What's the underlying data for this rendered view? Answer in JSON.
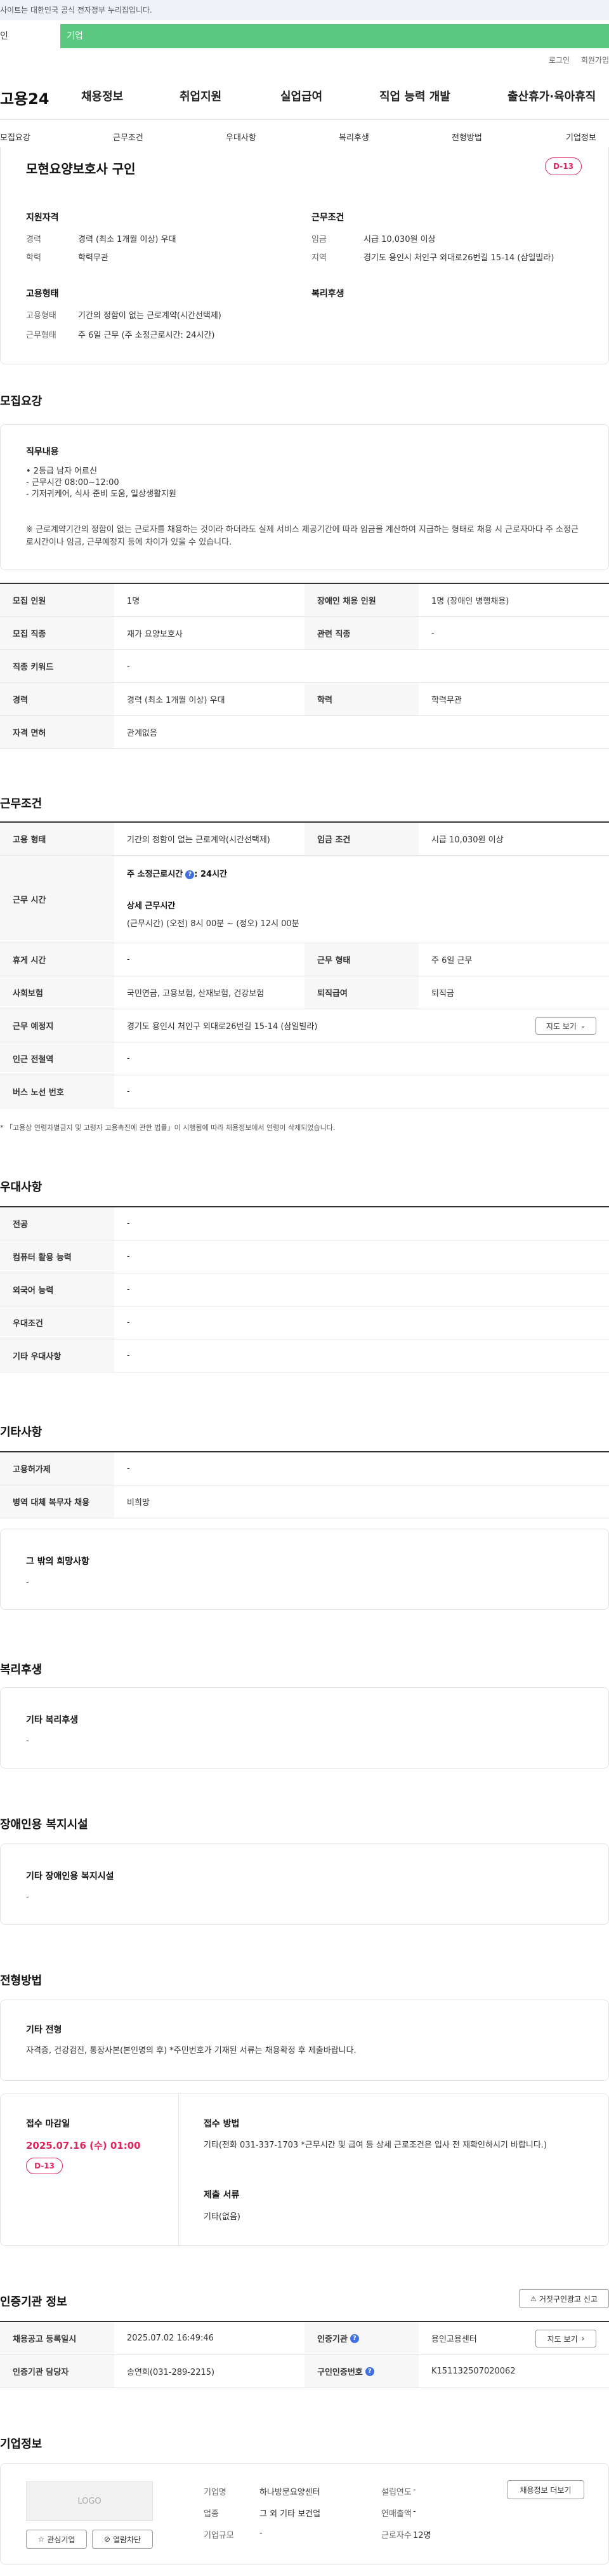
{
  "topbar": {
    "notice": "사이트는 대한민국 공식 전자정부 누리집입니다."
  },
  "tabs": {
    "individual": "인",
    "business": "기업"
  },
  "util": {
    "login": "로그인",
    "join": "회원가입"
  },
  "header": {
    "logo": "고용24",
    "nav": [
      "채용정보",
      "취업지원",
      "실업급여",
      "직업 능력 개발",
      "출산휴가·육아휴직"
    ]
  },
  "subnav": [
    "모집요강",
    "근무조건",
    "우대사항",
    "복리후생",
    "전형방법",
    "기업정보"
  ],
  "summary": {
    "title": "모현요양보호사 구인",
    "dday": "D-13",
    "qual_title": "지원자격",
    "career_label": "경력",
    "career": "경력 (최소 1개월 이상) 우대",
    "edu_label": "학력",
    "edu": "학력무관",
    "emp_title": "고용형태",
    "emptype_label": "고용형태",
    "emptype": "기간의 정함이 없는 근로계약(시간선택제)",
    "work_label": "근무형태",
    "work": "주 6일 근무 (주 소정근로시간: 24시간)",
    "cond_title": "근무조건",
    "wage_label": "임금",
    "wage": "시급 10,030원 이상",
    "area_label": "지역",
    "area": "경기도 용인시 처인구 외대로26번길 15-14 (삼일빌라)",
    "welfare_title": "복리후생"
  },
  "recruit": {
    "heading": "모집요강",
    "job_title": "직무내용",
    "job_lines": [
      "• 2등급 남자 어르신",
      "- 근무시간 08:00~12:00",
      "- 기저귀케어, 식사 준비 도움, 일상생활지원"
    ],
    "notice": "※ 근로계약기간의 정함이 없는 근로자를 채용하는 것이라 하더라도 실제 서비스 제공기간에 따라 임금을 계산하여 지급하는 형태로 채용 시 근로자마다 주 소정근로시간이나 임금, 근무예정지 등에 차이가 있을 수 있습니다.",
    "rows": [
      {
        "l1": "모집 인원",
        "v1": "1명",
        "l2": "장애인 채용 인원",
        "v2": "1명 (장애인 병행채용)"
      },
      {
        "l1": "모집 직종",
        "v1": "재가 요양보호사",
        "l2": "관련 직종",
        "v2": "-"
      },
      {
        "l1": "직종 키워드",
        "v1": "-"
      },
      {
        "l1": "경력",
        "v1": "경력 (최소 1개월 이상) 우대",
        "l2": "학력",
        "v2": "학력무관"
      },
      {
        "l1": "자격 면허",
        "v1": "관계없음"
      }
    ]
  },
  "conditions": {
    "heading": "근무조건",
    "type_label": "고용 형태",
    "type": "기간의 정함이 없는 근로계약(시간선택제)",
    "wage_label": "임금 조건",
    "wage": "시급 10,030원 이상",
    "hours_label": "근무 시간",
    "weekly_label": "주 소정근로시간",
    "weekly": ": 24시간",
    "detail_label": "상세 근무시간",
    "detail": "(근무시간) (오전) 8시 00분 ~ (정오) 12시 00분",
    "break_label": "휴게 시간",
    "break": "-",
    "form_label": "근무 형태",
    "form": "주 6일 근무",
    "ins_label": "사회보험",
    "ins": "국민연금, 고용보험, 산재보험, 건강보험",
    "sev_label": "퇴직급여",
    "sev": "퇴직금",
    "place_label": "근무 예정지",
    "place": "경기도 용인시 처인구 외대로26번길 15-14 (삼일빌라)",
    "map_btn": "지도 보기",
    "subway_label": "인근 전철역",
    "subway": "-",
    "bus_label": "버스 노선 번호",
    "bus": "-",
    "footnote": "* 「고용상 연령차별금지 및 고령자 고용촉진에 관한 법률」이 시행됨에 따라 채용정보에서 연령이 삭제되었습니다."
  },
  "preference": {
    "heading": "우대사항",
    "rows": [
      {
        "l": "전공",
        "v": "-"
      },
      {
        "l": "컴퓨터 활용 능력",
        "v": "-"
      },
      {
        "l": "외국어 능력",
        "v": "-"
      },
      {
        "l": "우대조건",
        "v": "-"
      },
      {
        "l": "기타 우대사항",
        "v": "-"
      }
    ]
  },
  "etc": {
    "heading": "기타사항",
    "rows": [
      {
        "l": "고용허가제",
        "v": "-"
      },
      {
        "l": "병역 대체 복무자 채용",
        "v": "비희망"
      }
    ],
    "other_title": "그 밖의 희망사항",
    "other": "-"
  },
  "welfare": {
    "heading": "복리후생",
    "title": "기타 복리후생",
    "value": "-"
  },
  "facility": {
    "heading": "장애인용 복지시설",
    "title": "기타 장애인용 복지시설",
    "value": "-"
  },
  "selection": {
    "heading": "전형방법",
    "title": "기타 전형",
    "text": "자격증, 건강검진, 통장사본(본인명의 후) *주민번호가 기재된 서류는 채용확정 후 제출바랍니다.",
    "deadline_title": "접수 마감일",
    "deadline": "2025.07.16 (수) 01:00",
    "dday": "D-13",
    "method_title": "접수 방법",
    "method": "기타(전화 031-337-1703 *근무시간 및 급여 등 상세 근로조건은 입사 전 재확인하시기 바랍니다.)",
    "docs_title": "제출 서류",
    "docs": "기타(없음)"
  },
  "agency": {
    "heading": "인증기관 정보",
    "report_btn": "거짓구인광고 신고",
    "view_btn": "지도 보기",
    "reg_label": "채용공고 등록일시",
    "reg": "2025.07.02 16:49:46",
    "org_label": "인증기관",
    "org": "용인고용센터",
    "mgr_label": "인증기관 담당자",
    "mgr": "송연희(031-289-2215)",
    "no_label": "구인인증번호",
    "no": "K151132507020062"
  },
  "company": {
    "heading": "기업정보",
    "logo": "LOGO",
    "fav_btn": "관심기업",
    "block_btn": "열람차단",
    "jobs_btn": "채용정보 더보기",
    "name_label": "기업명",
    "name": "하나방문요양센터",
    "year_label": "설립연도",
    "year": "-",
    "ind_label": "업종",
    "ind": "그 외 기타 보건업",
    "sales_label": "연매출액",
    "sales": "-",
    "size_label": "기업규모",
    "size": "-",
    "emp_label": "근로자수",
    "emp": "12명"
  }
}
